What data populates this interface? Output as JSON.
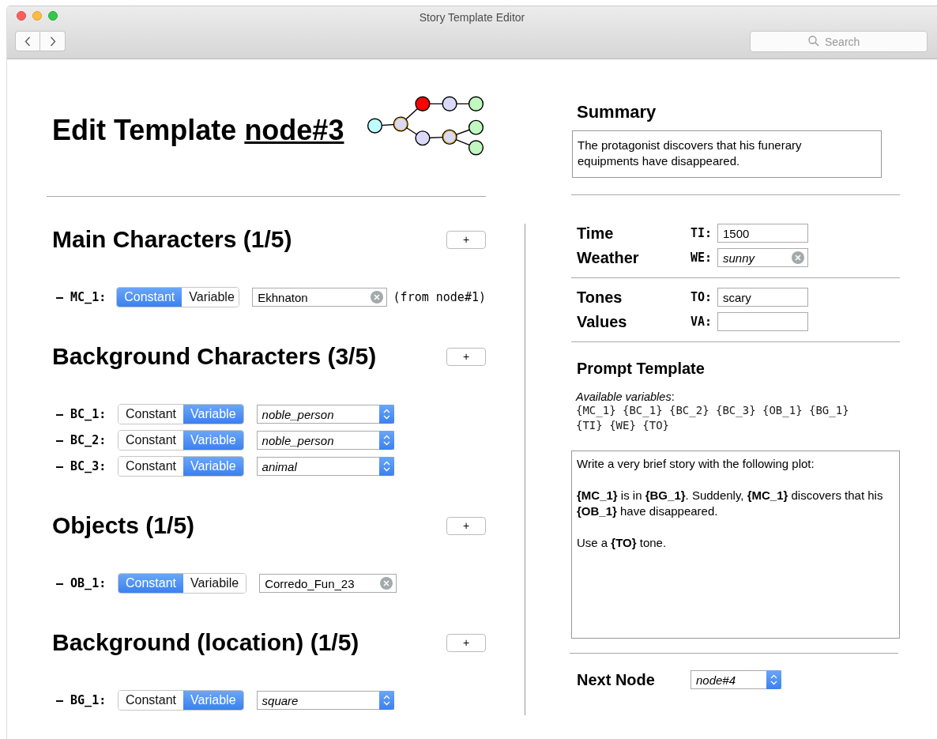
{
  "window": {
    "title": "Story Template Editor",
    "search": {
      "placeholder": "Search"
    }
  },
  "header": {
    "title": "Edit Template",
    "node": "node#3"
  },
  "summary": {
    "title": "Summary",
    "text": "The protagonist discovers that his funerary equipments have disappeared."
  },
  "sections": [
    {
      "title": "Main Characters (1/5)",
      "add": "+",
      "entries": [
        {
          "label": "– MC_1:",
          "options": [
            {
              "label": "Constant",
              "selected": true
            },
            {
              "label": "Variable",
              "selected": false
            }
          ],
          "field": {
            "kind": "clearable",
            "value": "Ekhnaton"
          },
          "note": "(from node#1)"
        }
      ]
    },
    {
      "title": "Background Characters (3/5)",
      "add": "+",
      "entries": [
        {
          "label": "– BC_1:",
          "options": [
            {
              "label": "Constant",
              "selected": false
            },
            {
              "label": "Variable",
              "selected": true
            }
          ],
          "field": {
            "kind": "select",
            "value": "noble_person",
            "italic": true
          }
        },
        {
          "label": "– BC_2:",
          "options": [
            {
              "label": "Constant",
              "selected": false
            },
            {
              "label": "Variable",
              "selected": true
            }
          ],
          "field": {
            "kind": "select",
            "value": "noble_person",
            "italic": true
          }
        },
        {
          "label": "– BC_3:",
          "options": [
            {
              "label": "Constant",
              "selected": false
            },
            {
              "label": "Variable",
              "selected": true
            }
          ],
          "field": {
            "kind": "select",
            "value": "animal",
            "italic": true
          }
        }
      ]
    },
    {
      "title": "Objects (1/5)",
      "add": "+",
      "entries": [
        {
          "label": "– OB_1:",
          "options": [
            {
              "label": "Constant",
              "selected": true
            },
            {
              "label": "Variabile",
              "selected": false
            }
          ],
          "field": {
            "kind": "clearable",
            "value": "Corredo_Fun_23"
          }
        }
      ]
    },
    {
      "title": "Background (location) (1/5)",
      "add": "+",
      "entries": [
        {
          "label": "– BG_1:",
          "options": [
            {
              "label": "Constant",
              "selected": false
            },
            {
              "label": "Variable",
              "selected": true
            }
          ],
          "field": {
            "kind": "select",
            "value": "square",
            "italic": true
          }
        }
      ]
    }
  ],
  "settings": [
    [
      {
        "name": "Time",
        "code": "TI:",
        "field": {
          "kind": "text",
          "value": "1500"
        }
      },
      {
        "name": "Weather",
        "code": "WE:",
        "field": {
          "kind": "clearable",
          "value": "sunny",
          "italic": true
        }
      }
    ],
    [
      {
        "name": "Tones",
        "code": "TO:",
        "field": {
          "kind": "text",
          "value": "scary"
        }
      },
      {
        "name": "Values",
        "code": "VA:",
        "field": {
          "kind": "text"
        }
      }
    ]
  ],
  "prompt": {
    "title": "Prompt Template",
    "available_label": "Available variables",
    "available_colon": ":",
    "variables_line_1": "{MC_1} {BC_1} {BC_2} {BC_3} {OB_1} {BG_1}",
    "variables_line_2": "{TI} {WE} {TO}",
    "paragraphs": [
      "Write a very brief story with the following plot:",
      "**{MC_1}** is in **{BG_1}**. Suddenly, **{MC_1}** discovers that his **{OB_1}** have disappeared.",
      "Use a **{TO}** tone."
    ]
  },
  "next_node": {
    "label": "Next Node",
    "field": {
      "kind": "select",
      "value": "node#4",
      "italic": true
    }
  }
}
